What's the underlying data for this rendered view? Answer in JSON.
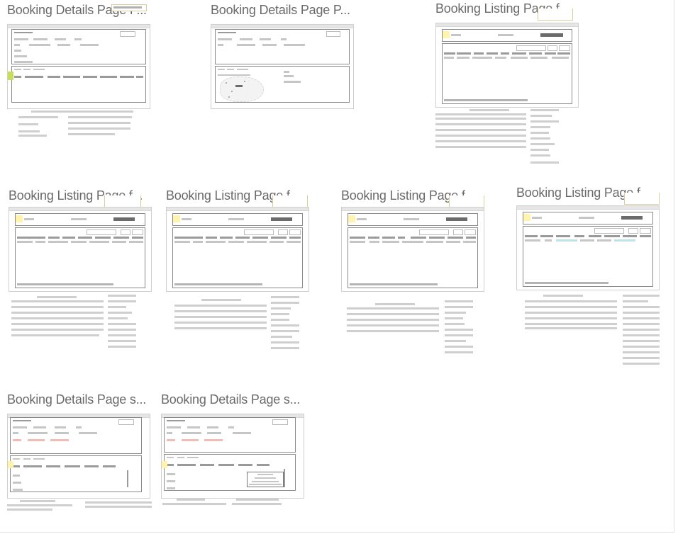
{
  "board": {
    "cards": [
      {
        "title": "Booking Details Page P..."
      },
      {
        "title": "Booking Details Page P..."
      },
      {
        "title": "Booking Listing Page f..."
      },
      {
        "title": "Booking Listing Page f..."
      },
      {
        "title": "Booking Listing Page f..."
      },
      {
        "title": "Booking Listing Page f..."
      },
      {
        "title": "Booking Listing Page f..."
      },
      {
        "title": "Booking Details Page s..."
      },
      {
        "title": "Booking Details Page s..."
      }
    ]
  },
  "colors": {
    "title_text": "#6a6a6a",
    "wire_line": "#c6c6c6",
    "wire_dark_button": "#6b6b6b",
    "highlight_yellow": "#fff3b0",
    "highlight_green": "#c7de5a",
    "highlight_pink": "#f2bcb4",
    "highlight_cyan": "#bfe3ea"
  }
}
